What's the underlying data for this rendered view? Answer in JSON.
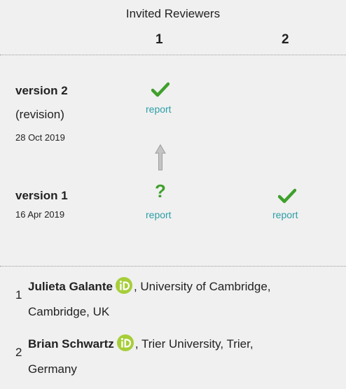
{
  "header": {
    "title": "Invited Reviewers",
    "col1": "1",
    "col2": "2"
  },
  "versions": [
    {
      "label": "version 2",
      "note": "(revision)",
      "date": "28 Oct 2019",
      "reviewer1": {
        "status": "approved",
        "report": "report"
      }
    },
    {
      "label": "version 1",
      "date": "16 Apr 2019",
      "reviewer1": {
        "status": "approved-with-reservations",
        "report": "report"
      },
      "reviewer2": {
        "status": "approved",
        "report": "report"
      }
    }
  ],
  "status_glyphs": {
    "approved": "✔",
    "reservations": "?"
  },
  "reviewers": [
    {
      "num": "1",
      "name": "Julieta Galante",
      "affiliation_a": ", University of Cambridge,",
      "affiliation_b": "Cambridge, UK"
    },
    {
      "num": "2",
      "name": "Brian Schwartz",
      "affiliation_a": ", Trier University, Trier,",
      "affiliation_b": "Germany"
    }
  ],
  "colors": {
    "accent": "#2c9ea6",
    "approved": "#3fa02b",
    "orcid": "#a6ce39"
  }
}
